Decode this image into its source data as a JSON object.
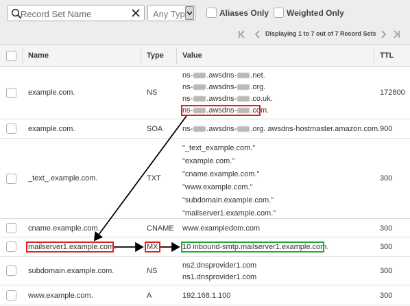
{
  "toolbar": {
    "search_placeholder": "Record Set Name",
    "type_filter": "Any Type",
    "aliases_label": "Aliases Only",
    "weighted_label": "Weighted Only",
    "pager_text": "Displaying 1 to 7 out of 7 Record Sets",
    "icons": [
      "search-icon",
      "clear-icon",
      "dropdown-arrow-icon",
      "first-page-icon",
      "prev-page-icon",
      "next-page-icon",
      "last-page-icon"
    ]
  },
  "table": {
    "headers": {
      "name": "Name",
      "type": "Type",
      "value": "Value",
      "ttl": "TTL"
    },
    "rows": [
      {
        "name": "example.com.",
        "type": "NS",
        "ttl": "172800",
        "values": [
          {
            "prefix": "ns-",
            "mid": ".awsdns-",
            "suffix": ".net."
          },
          {
            "prefix": "ns-",
            "mid": ".awsdns-",
            "suffix": ".org."
          },
          {
            "prefix": "ns-",
            "mid": ".awsdns-",
            "suffix": ".co.uk."
          },
          {
            "prefix": "ns-",
            "mid": ".awsdns-",
            "suffix": ".com."
          }
        ]
      },
      {
        "name": "example.com.",
        "type": "SOA",
        "ttl": "900",
        "values": [
          {
            "prefix": "ns-",
            "mid": ".awsdns-",
            "suffix": ".org. awsdns-hostmaster.amazon.com."
          }
        ]
      },
      {
        "name": "_text_.example.com.",
        "type": "TXT",
        "ttl": "300",
        "values": [
          "\"_text_example.com.\"",
          "\"example.com.\"",
          "\"cname.example.com.\"",
          "\"www.example.com.\"",
          "\"subdomain.example.com.\"",
          "\"mailserver1.example.com.\""
        ]
      },
      {
        "name": "cname.example.com.",
        "type": "CNAME",
        "ttl": "300",
        "values": [
          "www.exampledom.com"
        ]
      },
      {
        "name": "mailserver1.example.com.",
        "type": "MX",
        "ttl": "300",
        "values": [
          "10 inbound-smtp.mailserver1.example.com."
        ]
      },
      {
        "name": "subdomain.example.com.",
        "type": "NS",
        "ttl": "300",
        "values": [
          "ns2.dnsprovider1.com",
          "ns1.dnsprovider1.com"
        ]
      },
      {
        "name": "www.example.com.",
        "type": "A",
        "ttl": "300",
        "values": [
          "192.168.1.100"
        ]
      }
    ]
  },
  "annotations": {
    "highlight_red": "#e02020",
    "highlight_green": "#1faa2e",
    "arrow_color": "#000000"
  }
}
